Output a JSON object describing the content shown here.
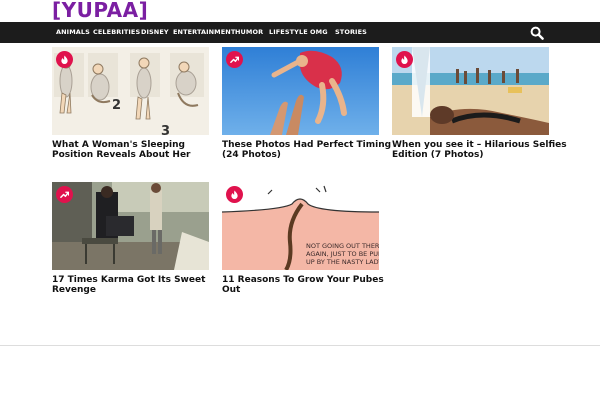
{
  "site": {
    "logo": "[YUPAA]"
  },
  "nav": {
    "items": [
      "ANIMALS",
      "CELEBRITIES",
      "DISNEY",
      "ENTERTAINMENT",
      "HUMOR",
      "LIFESTYLE",
      "OMG",
      "STORIES"
    ]
  },
  "articles": [
    {
      "title": "What A Woman's Sleeping Position Reveals About Her",
      "badge": "flame-icon",
      "thumb_numbers": [
        "2",
        "3"
      ]
    },
    {
      "title": "These Photos Had Perfect Timing (24 Photos)",
      "badge": "trending-icon"
    },
    {
      "title": "When you see it – Hilarious Selfies Edition (7 Photos)",
      "badge": "flame-icon"
    },
    {
      "title": "17 Times Karma Got Its Sweet Revenge",
      "badge": "trending-icon"
    },
    {
      "title": "11 Reasons To Grow Your Pubes Out",
      "badge": "flame-icon",
      "thumb_text": "NOT GOING OUT THERE AGAIN, JUST TO BE PULLED UP BY THE NASTY LADY"
    }
  ],
  "colors": {
    "brand": "#7b1fa2",
    "nav_bg": "#1c1c1c",
    "badge": "#e0124d"
  }
}
